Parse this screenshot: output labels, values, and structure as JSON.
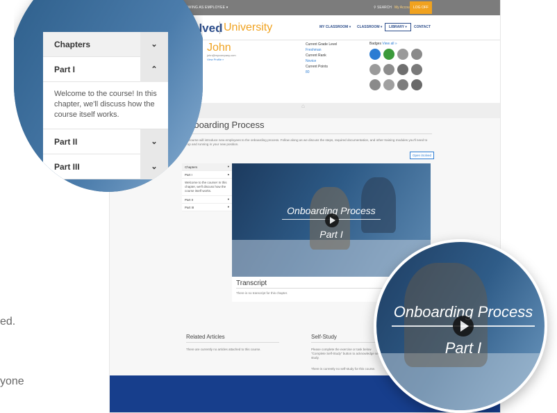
{
  "topbar": {
    "viewing": "VIEWING AS EMPLOYEE ▾",
    "search": "⚲ SEARCH",
    "my_account": "My Account",
    "log": "LOG OFF"
  },
  "header": {
    "logo_brand": "iSolved",
    "logo_univ": "University",
    "nav": [
      "MY CLASSROOM ▾",
      "CLASSROOM ▾",
      "LIBRARY ▾",
      "CONTACT"
    ]
  },
  "profile": {
    "name": "John",
    "email": "john@mycompany.com",
    "view_profile": "View Profile »",
    "grade_label": "Current Grade Level",
    "grade_value": "Freshman",
    "rank_label": "Current Rank",
    "rank_value": "Novice",
    "points_label": "Current Points",
    "points_value": "80",
    "badges_label": "Badges",
    "badges_view_all": "View all »"
  },
  "course": {
    "title": "Onboarding Process",
    "description": "This course will introduce new employees to the onboarding process. Follow along as we discuss the steps, required documentation, and other training modules you'll need to get up and running in your new position.",
    "open_button": "Open iSolved"
  },
  "chapters": {
    "heading": "Chapters",
    "part1": "Part I",
    "part1_desc": "Welcome to the course! In this chapter, we'll discuss how the course itself works.",
    "part2": "Part II",
    "part3": "Part III"
  },
  "video": {
    "title_line1": "Onboarding Process",
    "title_line2": "Part I"
  },
  "transcript": {
    "heading": "Transcript",
    "text": "There is no transcript for this chapter."
  },
  "related": {
    "heading": "Related Articles",
    "text": "There are currently no articles attached to this course."
  },
  "self_study": {
    "heading": "Self-Study",
    "text": "Please complete the exercise or task below \"Complete Self-Study\" button to acknowledge self-study.",
    "none": "There is currently no self-study for this course."
  },
  "side_fragments": {
    "a": "ed.",
    "b": "yone"
  },
  "colors": {
    "brand_blue": "#2b4c8a",
    "accent_orange": "#f0a21f",
    "footer_blue": "#173e8c"
  },
  "icons": {
    "home": "home-icon",
    "chevron_down": "chevron-down-icon",
    "chevron_up": "chevron-up-icon",
    "play": "play-icon"
  }
}
